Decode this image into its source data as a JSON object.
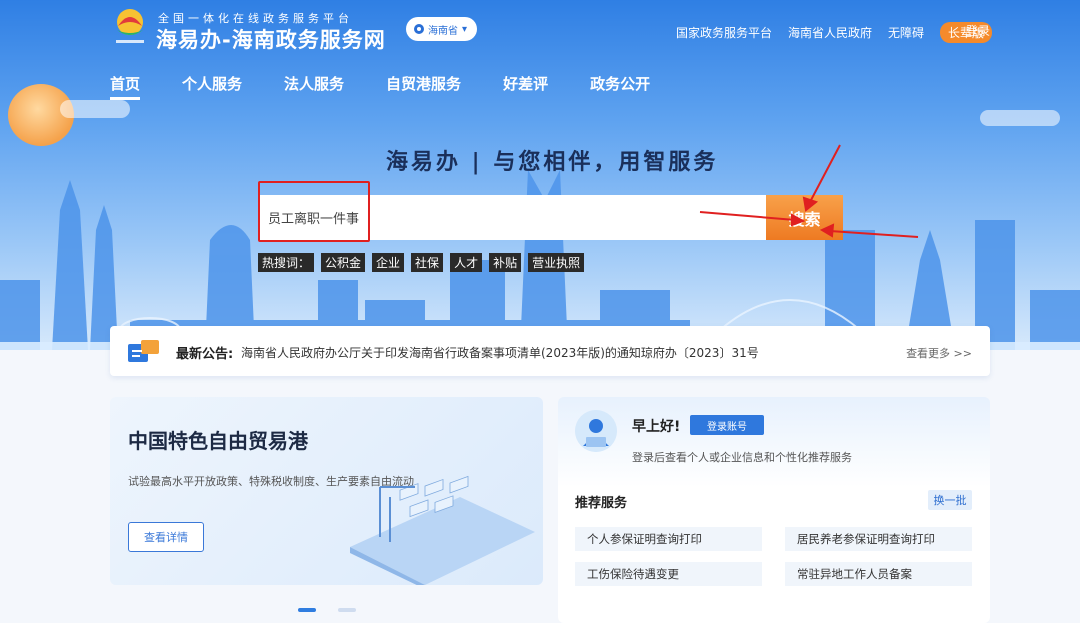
{
  "header": {
    "subtitle": "全国一体化在线政务服务平台",
    "title": "海易办-海南政务服务网",
    "province": "海南省",
    "top_links": [
      "国家政务服务平台",
      "海南省人民政府",
      "无障碍"
    ],
    "elder_mode": "长辈版",
    "login": "登录"
  },
  "nav": {
    "items": [
      "首页",
      "个人服务",
      "法人服务",
      "自贸港服务",
      "好差评",
      "政务公开"
    ],
    "active_index": 0
  },
  "hero": {
    "slogan": "海易办 | 与您相伴，用智服务"
  },
  "search": {
    "value": "员工离职一件事",
    "button": "搜索",
    "hot_label": "热搜词：",
    "hot_words": [
      "公积金",
      "企业",
      "社保",
      "人才",
      "补贴",
      "营业执照"
    ]
  },
  "notice": {
    "label": "最新公告:",
    "text": "海南省人民政府办公厅关于印发海南省行政备案事项清单(2023年版)的通知琼府办〔2023〕31号",
    "more": "查看更多 >>"
  },
  "ftz_card": {
    "title": "中国特色自由贸易港",
    "desc": "试验最高水平开放政策、特殊税收制度、生产要素自由流动",
    "button": "查看详情"
  },
  "user_card": {
    "greeting": "早上好!",
    "login_button": "登录账号",
    "hint": "登录后查看个人或企业信息和个性化推荐服务",
    "rec_title": "推荐服务",
    "swap": "换一批",
    "services": [
      "个人参保证明查询打印",
      "居民养老参保证明查询打印",
      "工伤保险待遇变更",
      "常驻异地工作人员备案"
    ]
  },
  "colors": {
    "primary": "#2f78dd",
    "orange": "#ee7a22",
    "annotation_red": "#e02020"
  }
}
